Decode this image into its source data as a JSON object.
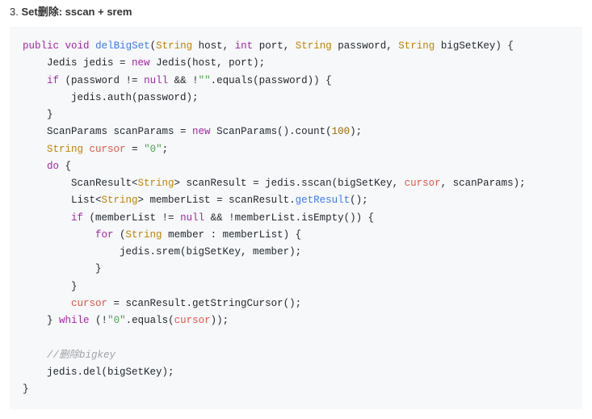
{
  "heading": {
    "num": "3.",
    "title": "Set删除: sscan + srem"
  },
  "code": {
    "kw_public": "public",
    "kw_void": "void",
    "fn_name": "delBigSet",
    "ty_String": "String",
    "p_host": "host",
    "kw_int": "int",
    "p_port": "port",
    "p_password": "password",
    "p_bigSetKey": "bigSetKey",
    "l2a": "Jedis jedis = ",
    "kw_new": "new",
    "l2b": " Jedis(host, port);",
    "kw_if": "if",
    "l3a": " (password != ",
    "kw_null": "null",
    "l3b": " && !",
    "str_empty": "\"\"",
    "l3c": ".equals(password)) {",
    "l4": "jedis.auth(password);",
    "brace_close": "}",
    "l6a": "ScanParams scanParams = ",
    "l6b": " ScanParams().count(",
    "num_100": "100",
    "l6c": ");",
    "l7a": " ",
    "var_cursor": "cursor",
    "l7b": " = ",
    "str_zero": "\"0\"",
    "l7c": ";",
    "kw_do": "do",
    "l8": " {",
    "l9a": "ScanResult<",
    "l9b": "> scanResult = jedis.sscan(bigSetKey, ",
    "l9c": ", scanParams);",
    "l10a": "List<",
    "l10b": "> memberList = scanResult.",
    "call_getResult": "getResult",
    "l10c": "();",
    "l11a": " (memberList != ",
    "l11b": " && !memberList.isEmpty()) {",
    "kw_for": "for",
    "l12a": " (",
    "l12b": " member : memberList) {",
    "l13": "jedis.srem(bigSetKey, member);",
    "l16a": " = scanResult.getStringCursor();",
    "kw_while": "while",
    "l17a": " (!",
    "l17b": ".equals(",
    "l17c": "));",
    "comment": "//删除bigkey",
    "l19": "jedis.del(bigSetKey);"
  }
}
